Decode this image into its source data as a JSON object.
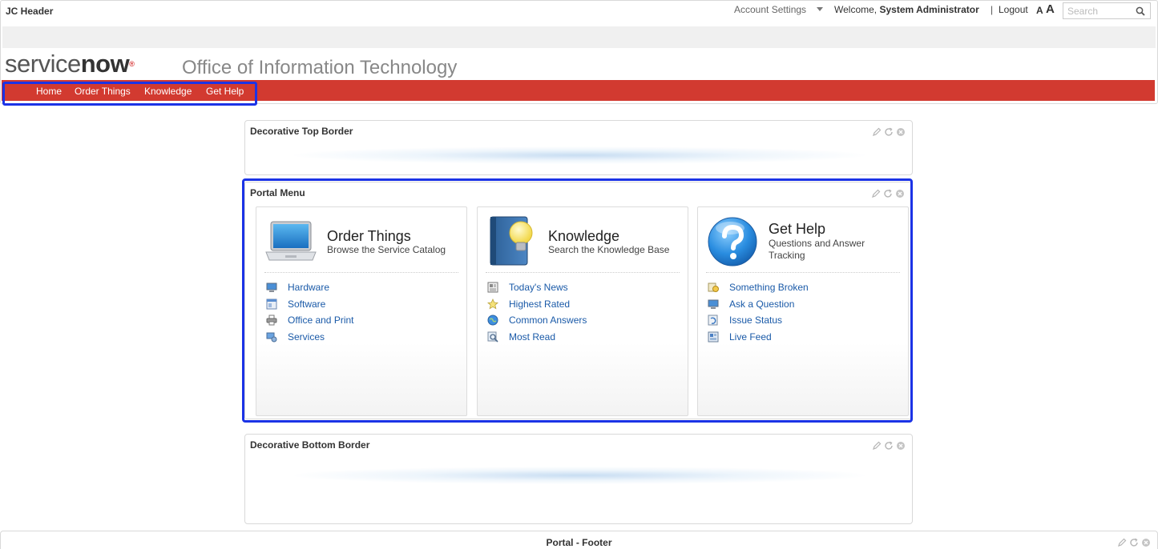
{
  "header": {
    "widget_title": "JC Header",
    "account_settings": "Account Settings",
    "welcome_prefix": "Welcome,",
    "user_name": "System Administrator",
    "separator": "|",
    "logout": "Logout",
    "font_small": "A",
    "font_large": "A",
    "search_placeholder": "Search",
    "logo_service": "service",
    "logo_now": "now",
    "logo_reg": "®",
    "org_title": "Office of Information Technology",
    "nav": [
      "Home",
      "Order Things",
      "Knowledge",
      "Get Help"
    ],
    "nav_color": "#d23a30"
  },
  "top_border": {
    "title": "Decorative Top Border"
  },
  "portal_menu": {
    "title": "Portal Menu",
    "panels": [
      {
        "title": "Order Things",
        "subtitle": "Browse the Service Catalog",
        "hero_icon": "laptop-icon",
        "links": [
          {
            "label": "Hardware",
            "icon": "monitor-icon"
          },
          {
            "label": "Software",
            "icon": "window-icon"
          },
          {
            "label": "Office and Print",
            "icon": "printer-icon"
          },
          {
            "label": "Services",
            "icon": "services-icon"
          }
        ]
      },
      {
        "title": "Knowledge",
        "subtitle": "Search the Knowledge Base",
        "hero_icon": "book-lightbulb-icon",
        "links": [
          {
            "label": "Today's News",
            "icon": "newspaper-icon"
          },
          {
            "label": "Highest Rated",
            "icon": "star-icon"
          },
          {
            "label": "Common Answers",
            "icon": "globe-icon"
          },
          {
            "label": "Most Read",
            "icon": "magnifier-icon"
          }
        ]
      },
      {
        "title": "Get Help",
        "subtitle": "Questions and Answer Tracking",
        "hero_icon": "question-mark-icon",
        "links": [
          {
            "label": "Something Broken",
            "icon": "broken-icon"
          },
          {
            "label": "Ask a Question",
            "icon": "monitor-icon"
          },
          {
            "label": "Issue Status",
            "icon": "status-icon"
          },
          {
            "label": "Live Feed",
            "icon": "feed-icon"
          }
        ]
      }
    ],
    "link_color": "#1a5aa8"
  },
  "bottom_border": {
    "title": "Decorative Bottom Border"
  },
  "footer": {
    "title": "Portal - Footer"
  },
  "highlight_color": "#1b33e6"
}
